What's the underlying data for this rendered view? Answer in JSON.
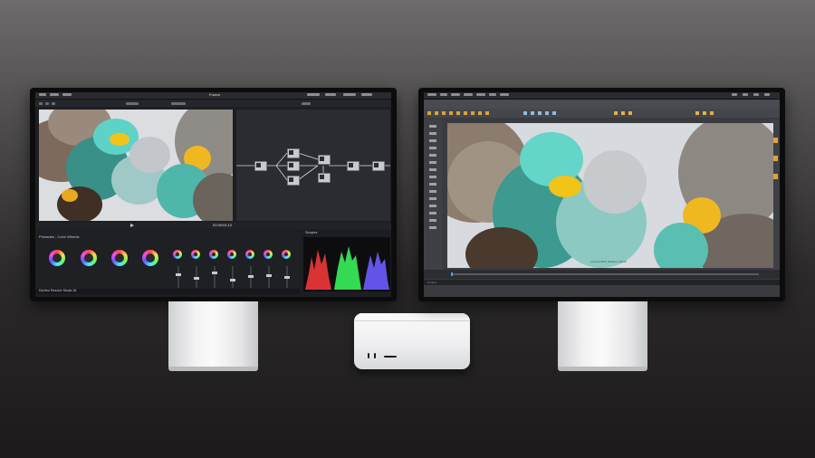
{
  "scene": {
    "description_labels": {
      "left_app_title": "Fusion",
      "left_app_badge": "DaVinci Resolve Studio 18",
      "left_timecode": "01:00:01:12",
      "left_scope_label": "Scopes",
      "left_color_panel_label": "Primaries - Color Wheels",
      "right_app_label": "Houdini",
      "right_viewport_caption": "Lens Id: 004 | 42.0mm | 01:00"
    }
  },
  "colors": {
    "accent_teal": "#39c7b6",
    "accent_yellow": "#f2c319",
    "scope_red": "#ff3b3b",
    "scope_green": "#3bff5e",
    "scope_blue": "#6b5cff"
  }
}
